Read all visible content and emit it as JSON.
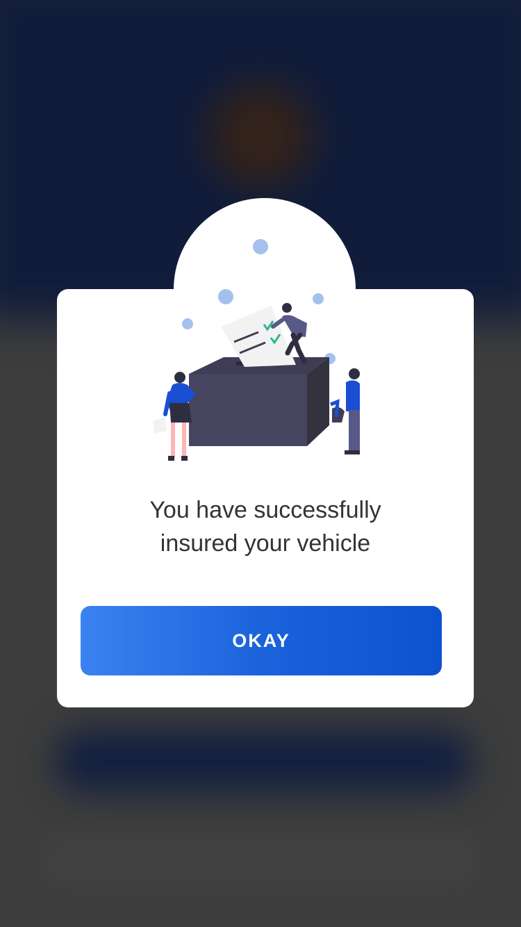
{
  "dialog": {
    "message_line1": "You have successfully",
    "message_line2": "insured your vehicle",
    "okay_label": "OKAY",
    "illustration_icon": "ballot-box-voting-illustration"
  },
  "colors": {
    "accent_start": "#3b82f1",
    "accent_end": "#0d52cf",
    "text": "#333333",
    "backdrop": "#3d3d3d"
  }
}
